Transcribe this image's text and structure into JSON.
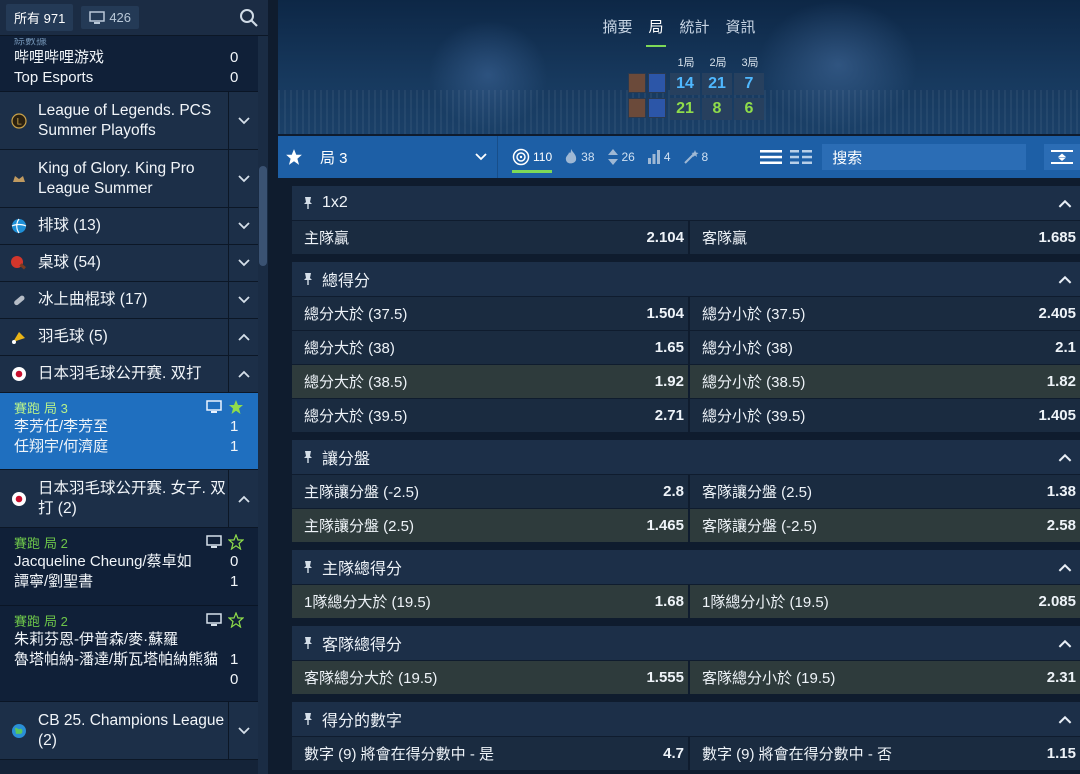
{
  "sidebar": {
    "all_label": "所有 971",
    "monitor_count": "426",
    "top_match": {
      "partial_label": "綜數據",
      "team1": "哔哩哔哩游戏",
      "score1": "0",
      "team2": "Top Esports",
      "score2": "0"
    },
    "leagues_a": [
      {
        "name": "League of Legends. PCS Summer Playoffs",
        "icon": "lol-icon"
      },
      {
        "name": "King of Glory. King Pro League Summer",
        "icon": "kog-icon"
      }
    ],
    "sports": [
      {
        "name": "排球 (13)",
        "icon": "volleyball-icon",
        "chev": "down"
      },
      {
        "name": "桌球 (54)",
        "icon": "table-tennis-icon",
        "chev": "down"
      },
      {
        "name": "冰上曲棍球 (17)",
        "icon": "hockey-icon",
        "chev": "down"
      },
      {
        "name": "羽毛球 (5)",
        "icon": "badminton-icon",
        "chev": "up"
      }
    ],
    "league_jp1": "日本羽毛球公开赛. 双打",
    "live1": {
      "status": "賽跑",
      "period": "局 3",
      "team1": "李芳任/李芳至",
      "s1": "1",
      "team2": "任翔宇/何濟庭",
      "s2": "1"
    },
    "league_jp2": "日本羽毛球公开赛. 女子. 双打 (2)",
    "live2": {
      "status": "賽跑",
      "period": "局 2",
      "team1": "Jacqueline Cheung/蔡卓如",
      "s1": "0",
      "team2": "譚寧/劉聖書",
      "s2": "1"
    },
    "live3": {
      "status": "賽跑",
      "period": "局 2",
      "team1": "朱莉芬恩-伊普森/麥·蘇羅",
      "s1": "1",
      "team2": "魯塔帕納-潘達/斯瓦塔帕納熊貓",
      "s2": "0"
    },
    "league_cb": "CB 25. Champions League (2)"
  },
  "main": {
    "tabs": [
      "摘要",
      "局",
      "統計",
      "資訊"
    ],
    "active_tab": 1,
    "sets_header": [
      "1局",
      "2局",
      "3局"
    ],
    "score_rows": [
      {
        "values": [
          "14",
          "21",
          "7"
        ],
        "color": "#4fb8ff"
      },
      {
        "values": [
          "21",
          "8",
          "6"
        ],
        "color": "#8fdc4a"
      }
    ],
    "toolbar": {
      "period_select": "局 3",
      "counts": {
        "all": "110",
        "hot": "38",
        "updown": "26",
        "bars": "4",
        "wand": "8"
      },
      "search_placeholder": "搜索"
    },
    "markets": [
      {
        "title": "1x2",
        "pin": "pin-icon",
        "rows": [
          [
            {
              "label": "主隊贏",
              "value": "2.104"
            },
            {
              "label": "客隊贏",
              "value": "1.685"
            }
          ]
        ]
      },
      {
        "title": "總得分",
        "pin": "pin-icon",
        "rows": [
          [
            {
              "label": "總分大於 (37.5)",
              "value": "1.504"
            },
            {
              "label": "總分小於 (37.5)",
              "value": "2.405"
            }
          ],
          [
            {
              "label": "總分大於 (38)",
              "value": "1.65"
            },
            {
              "label": "總分小於 (38)",
              "value": "2.1"
            }
          ],
          [
            {
              "label": "總分大於 (38.5)",
              "value": "1.92",
              "hl": true
            },
            {
              "label": "總分小於 (38.5)",
              "value": "1.82",
              "hl": true
            }
          ],
          [
            {
              "label": "總分大於 (39.5)",
              "value": "2.71"
            },
            {
              "label": "總分小於 (39.5)",
              "value": "1.405"
            }
          ]
        ]
      },
      {
        "title": "讓分盤",
        "pin": "pin-icon",
        "rows": [
          [
            {
              "label": "主隊讓分盤 (-2.5)",
              "value": "2.8"
            },
            {
              "label": "客隊讓分盤 (2.5)",
              "value": "1.38"
            }
          ],
          [
            {
              "label": "主隊讓分盤 (2.5)",
              "value": "1.465",
              "hl": true
            },
            {
              "label": "客隊讓分盤 (-2.5)",
              "value": "2.58",
              "hl": true
            }
          ]
        ]
      },
      {
        "title": "主隊總得分",
        "pin": "pin-icon",
        "rows": [
          [
            {
              "label": "1隊總分大於 (19.5)",
              "value": "1.68",
              "hl": true
            },
            {
              "label": "1隊總分小於 (19.5)",
              "value": "2.085",
              "hl": true
            }
          ]
        ]
      },
      {
        "title": "客隊總得分",
        "pin": "pin-icon",
        "rows": [
          [
            {
              "label": "客隊總分大於 (19.5)",
              "value": "1.555",
              "hl": true
            },
            {
              "label": "客隊總分小於 (19.5)",
              "value": "2.31",
              "hl": true
            }
          ]
        ]
      },
      {
        "title": "得分的數字",
        "pin": "pin-icon",
        "rows": [
          [
            {
              "label": "數字 (9) 將會在得分數中 - 是",
              "value": "4.7"
            },
            {
              "label": "數字 (9) 將會在得分數中 - 否",
              "value": "1.15"
            }
          ]
        ]
      }
    ]
  },
  "colors": {
    "accent": "#1d5fa6",
    "live_green": "#6dc54a",
    "active_row": "#1f6fbf"
  }
}
